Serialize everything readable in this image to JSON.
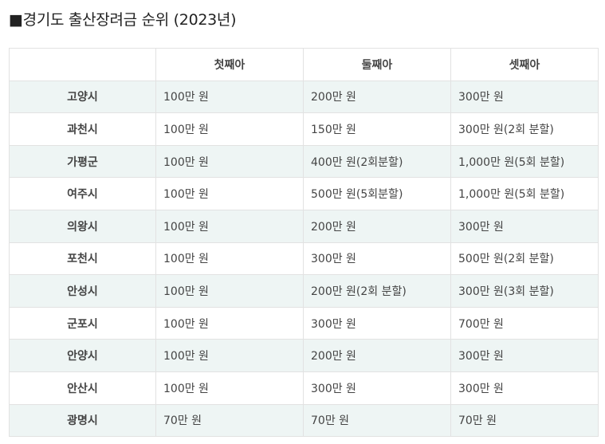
{
  "title": "■경기도 출산장려금 순위 (2023년)",
  "table": {
    "corner": "",
    "headers": [
      "첫째아",
      "둘째아",
      "셋째아"
    ],
    "rows": [
      {
        "city": "고양시",
        "values": [
          "100만 원",
          "200만 원",
          "300만 원"
        ]
      },
      {
        "city": "과천시",
        "values": [
          "100만 원",
          "150만 원",
          "300만 원(2회 분할)"
        ]
      },
      {
        "city": "가평군",
        "values": [
          "100만 원",
          "400만 원(2회분할)",
          "1,000만 원(5회 분할)"
        ]
      },
      {
        "city": "여주시",
        "values": [
          "100만 원",
          "500만 원(5회분할)",
          "1,000만 원(5회 분할)"
        ]
      },
      {
        "city": "의왕시",
        "values": [
          "100만 원",
          "200만 원",
          "300만 원"
        ]
      },
      {
        "city": "포천시",
        "values": [
          "100만 원",
          "300만 원",
          "500만 원(2회 분할)"
        ]
      },
      {
        "city": "안성시",
        "values": [
          "100만 원",
          "200만 원(2회 분할)",
          "300만 원(3회 분할)"
        ]
      },
      {
        "city": "군포시",
        "values": [
          "100만 원",
          "300만 원",
          "700만 원"
        ]
      },
      {
        "city": "안양시",
        "values": [
          "100만 원",
          "200만 원",
          "300만 원"
        ]
      },
      {
        "city": "안산시",
        "values": [
          "100만 원",
          "300만 원",
          "300만 원"
        ]
      },
      {
        "city": "광명시",
        "values": [
          "70만 원",
          "70만 원",
          "70만 원"
        ]
      }
    ]
  },
  "colors": {
    "stripe": "#eef5f4",
    "border": "#e2e2e2",
    "text": "#444444"
  }
}
